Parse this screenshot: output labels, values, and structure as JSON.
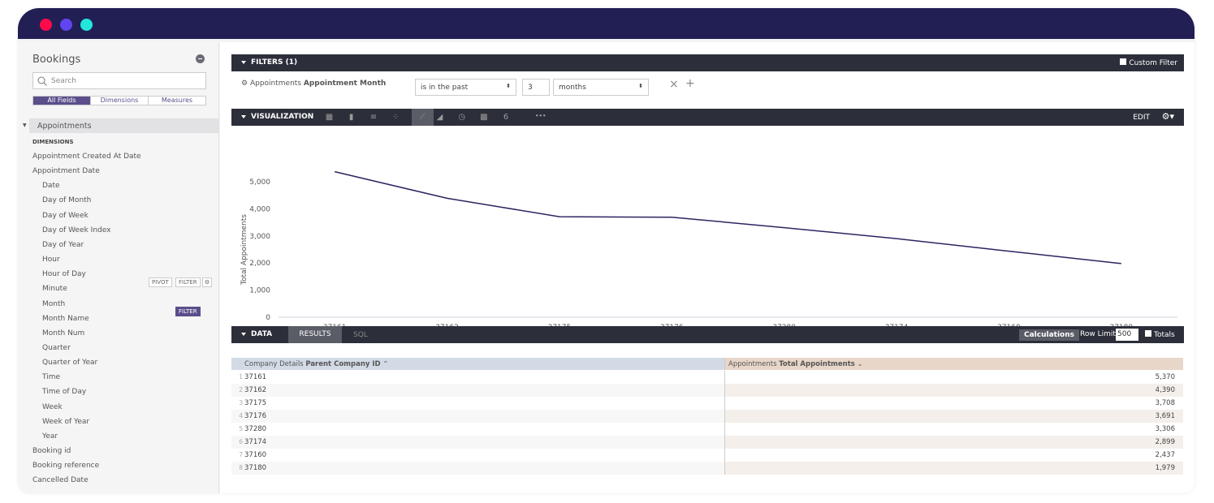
{
  "window": {
    "dots": [
      "#fe0a4a",
      "#6145f0",
      "#22e6dc"
    ],
    "bar_color": "#221f55"
  },
  "sidebar": {
    "title": "Bookings",
    "search_placeholder": "Search",
    "tabs": [
      "All Fields",
      "Dimensions",
      "Measures"
    ],
    "group": "Appointments",
    "section": "DIMENSIONS",
    "fields": [
      {
        "label": "Appointment Created At Date",
        "indent": false
      },
      {
        "label": "Appointment Date",
        "indent": false
      },
      {
        "label": "Date",
        "indent": true
      },
      {
        "label": "Day of Month",
        "indent": true
      },
      {
        "label": "Day of Week",
        "indent": true
      },
      {
        "label": "Day of Week Index",
        "indent": true
      },
      {
        "label": "Day of Year",
        "indent": true
      },
      {
        "label": "Hour",
        "indent": true
      },
      {
        "label": "Hour of Day",
        "indent": true
      },
      {
        "label": "Minute",
        "indent": true
      },
      {
        "label": "Month",
        "indent": true
      },
      {
        "label": "Month Name",
        "indent": true
      },
      {
        "label": "Month Num",
        "indent": true
      },
      {
        "label": "Quarter",
        "indent": true
      },
      {
        "label": "Quarter of Year",
        "indent": true
      },
      {
        "label": "Time",
        "indent": true
      },
      {
        "label": "Time of Day",
        "indent": true
      },
      {
        "label": "Week",
        "indent": true
      },
      {
        "label": "Week of Year",
        "indent": true
      },
      {
        "label": "Year",
        "indent": true
      },
      {
        "label": "Booking id",
        "indent": false
      },
      {
        "label": "Booking reference",
        "indent": false
      },
      {
        "label": "Cancelled Date",
        "indent": false
      }
    ],
    "hover_buttons": {
      "pivot": "PIVOT",
      "filter": "FILTER"
    },
    "active_filter": "FILTER",
    "accent": "#5b4e8a"
  },
  "filters": {
    "header": "FILTERS (1)",
    "custom_filter": "Custom Filter",
    "field_view": "Appointments",
    "field_name": "Appointment Month",
    "operator": "is in the past",
    "value": "3",
    "unit": "months"
  },
  "visualization": {
    "header": "VISUALIZATION",
    "edit": "EDIT",
    "selected_type": "line",
    "types": [
      "table",
      "column",
      "bar",
      "scatter",
      "line",
      "area",
      "pie",
      "map",
      "single-value"
    ],
    "single_value_glyph": "6",
    "more": "•••"
  },
  "chart_data": {
    "type": "line",
    "xlabel": "Parent Company ID",
    "ylabel": "Total Appointments",
    "categories": [
      "37161",
      "37162",
      "37175",
      "37176",
      "37280",
      "37174",
      "37160",
      "37180"
    ],
    "values": [
      5370,
      4390,
      3708,
      3691,
      3306,
      2899,
      2437,
      1979
    ],
    "ylim": [
      0,
      5000
    ],
    "yticks": [
      "0",
      "1,000",
      "2,000",
      "3,000",
      "4,000",
      "5,000"
    ],
    "line_color": "#2a2560",
    "grid": false
  },
  "data": {
    "header": "DATA",
    "tabs": [
      "RESULTS",
      "SQL"
    ],
    "calculations": "Calculations",
    "row_limit_label": "Row Limit",
    "row_limit": "500",
    "totals": "Totals",
    "col1_view": "Company Details",
    "col1_name": "Parent Company ID",
    "col2_view": "Appointments",
    "col2_name": "Total Appointments",
    "rows": [
      [
        "37161",
        "5,370"
      ],
      [
        "37162",
        "4,390"
      ],
      [
        "37175",
        "3,708"
      ],
      [
        "37176",
        "3,691"
      ],
      [
        "37280",
        "3,306"
      ],
      [
        "37174",
        "2,899"
      ],
      [
        "37160",
        "2,437"
      ],
      [
        "37180",
        "1,979"
      ]
    ]
  }
}
